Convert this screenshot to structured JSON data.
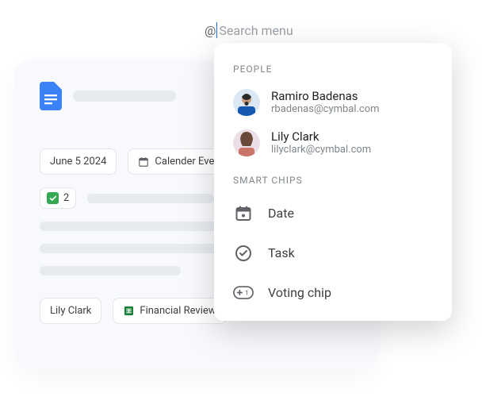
{
  "search": {
    "at_symbol": "@",
    "placeholder": "Search menu"
  },
  "document": {
    "chips": {
      "date": "June 5 2024",
      "event": "Calender Event",
      "vote_count": "2",
      "person": "Lily Clark",
      "file": "Financial Review"
    }
  },
  "dropdown": {
    "section_people": "PEOPLE",
    "section_chips": "SMART CHIPS",
    "people": [
      {
        "name": "Ramiro Badenas",
        "email": "rbadenas@cymbal.com"
      },
      {
        "name": "Lily Clark",
        "email": "lilyclark@cymbal.com"
      }
    ],
    "options": {
      "date": "Date",
      "task": "Task",
      "voting": "Voting chip"
    }
  }
}
